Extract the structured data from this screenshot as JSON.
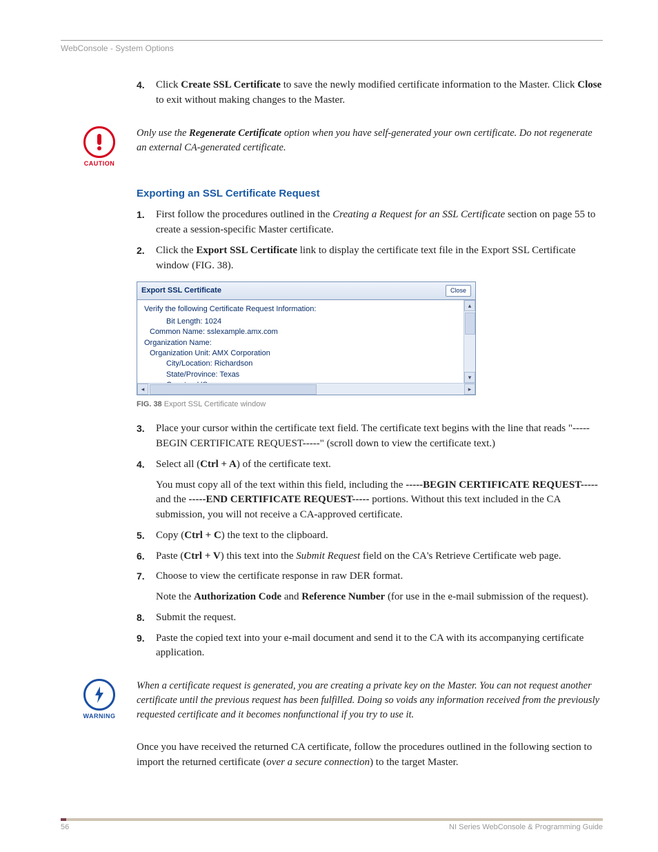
{
  "breadcrumb": "WebConsole - System Options",
  "step4": {
    "num": "4.",
    "pre": "Click ",
    "b1": "Create SSL Certificate",
    "mid": " to save the newly modified certificate information to the Master. Click ",
    "b2": "Close",
    "post": " to exit without making changes to the Master."
  },
  "caution": {
    "label": "CAUTION",
    "pre": "Only use the ",
    "bold": "Regenerate Certificate",
    "post": " option when you have self-generated your own certificate. Do not regenerate an external CA-generated certificate."
  },
  "section_title": "Exporting an SSL Certificate Request",
  "s1": {
    "num": "1.",
    "pre": "First follow the procedures outlined in the ",
    "it": "Creating a Request for an SSL Certificate",
    "post": " section on page 55 to create a session-specific Master certificate."
  },
  "s2": {
    "num": "2.",
    "pre": "Click the ",
    "b": "Export SSL Certificate",
    "post": " link to display the certificate text file in the Export SSL Certificate window (FIG. 38)."
  },
  "fig": {
    "title": "Export SSL Certificate",
    "close": "Close",
    "hdr": "Verify the following Certificate Request Information:",
    "lines": [
      "Bit Length: 1024",
      "Common Name: sslexample.amx.com",
      "Organization Name:",
      "Organization Unit: AMX Corporation",
      "City/Location: Richardson",
      "State/Province: Texas",
      "Country: US"
    ],
    "caption_b": "FIG. 38",
    "caption": "  Export SSL Certificate window"
  },
  "s3": {
    "num": "3.",
    "text": "Place your cursor within the certificate text field. The certificate text begins with the line that reads \"-----BEGIN CERTIFICATE REQUEST-----\" (scroll down to view the certificate text.)"
  },
  "s4": {
    "num": "4.",
    "pre": "Select all (",
    "b": "Ctrl + A",
    "post": ") of the certificate text.",
    "note_pre": "You must copy all of the text within this field, including the ",
    "note_b1": "-----BEGIN CERTIFICATE REQUEST-----",
    "note_mid": " and the ",
    "note_b2": "-----END CERTIFICATE REQUEST-----",
    "note_post": " portions. Without this text included in the CA submission, you will not receive a CA-approved certificate."
  },
  "s5": {
    "num": "5.",
    "pre": "Copy (",
    "b": "Ctrl + C",
    "post": ") the text to the clipboard."
  },
  "s6": {
    "num": "6.",
    "pre": "Paste (",
    "b": "Ctrl + V",
    "mid": ") this text into the ",
    "it": "Submit Request",
    "post": " field on the CA's Retrieve Certificate web page."
  },
  "s7": {
    "num": "7.",
    "text": "Choose to view the certificate response in raw DER format.",
    "note_pre": "Note the ",
    "note_b1": "Authorization Code",
    "note_mid": " and ",
    "note_b2": "Reference Number",
    "note_post": " (for use in the e-mail submission of the request)."
  },
  "s8": {
    "num": "8.",
    "text": "Submit the request."
  },
  "s9": {
    "num": "9.",
    "text": "Paste the copied text into your e-mail document and send it to the CA with its accompanying certificate application."
  },
  "warning": {
    "label": "WARNING",
    "text": "When a certificate request is generated, you are creating a private key on the Master. You can not request another certificate until the previous request has been fulfilled. Doing so voids any information received from the previously requested certificate and it becomes nonfunctional if you try to use it."
  },
  "closing": {
    "pre": "Once you have received the returned CA certificate, follow the procedures outlined in the following section to import the returned certificate (",
    "it": "over a secure connection",
    "post": ") to the target Master."
  },
  "footer": {
    "page": "56",
    "doc": "NI Series WebConsole & Programming Guide"
  }
}
